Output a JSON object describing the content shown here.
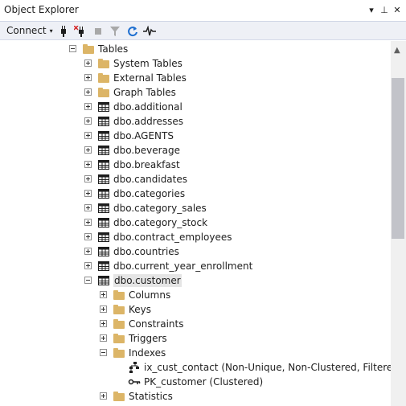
{
  "window": {
    "title": "Object Explorer"
  },
  "titlebar": {
    "dropdown_glyph": "▾",
    "pin_glyph": "⊥",
    "close_glyph": "✕"
  },
  "toolbar": {
    "connect_label": "Connect",
    "connect_caret": "▾"
  },
  "scrollbar": {
    "up_glyph": "▲"
  },
  "tree": {
    "tables": "Tables",
    "system_tables": "System Tables",
    "external_tables": "External Tables",
    "graph_tables": "Graph Tables",
    "items": [
      "dbo.additional",
      "dbo.addresses",
      "dbo.AGENTS",
      "dbo.beverage",
      "dbo.breakfast",
      "dbo.candidates",
      "dbo.categories",
      "dbo.category_sales",
      "dbo.category_stock",
      "dbo.contract_employees",
      "dbo.countries",
      "dbo.current_year_enrollment"
    ],
    "customer": {
      "label": "dbo.customer",
      "columns": "Columns",
      "keys": "Keys",
      "constraints": "Constraints",
      "triggers": "Triggers",
      "indexes": "Indexes",
      "index_1": "ix_cust_contact (Non-Unique, Non-Clustered, Filtered)",
      "index_2": "PK_customer (Clustered)",
      "statistics": "Statistics"
    }
  }
}
